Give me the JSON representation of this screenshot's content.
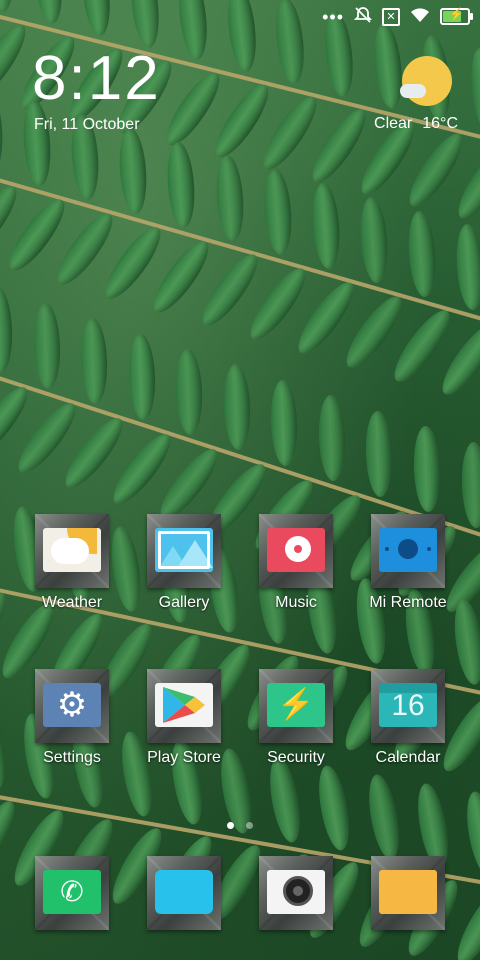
{
  "status_bar": {
    "icons": [
      "more-dots-icon",
      "mute-alarm-icon",
      "sim-error-icon",
      "wifi-icon",
      "battery-charging-icon"
    ],
    "battery_color": "#7ad45a"
  },
  "clock_widget": {
    "time": "8:12",
    "date": "Fri, 11 October",
    "weather_condition": "Clear",
    "temperature": "16°C"
  },
  "apps": [
    {
      "label": "Weather",
      "icon": "weather-icon"
    },
    {
      "label": "Gallery",
      "icon": "gallery-icon"
    },
    {
      "label": "Music",
      "icon": "music-icon"
    },
    {
      "label": "Mi Remote",
      "icon": "remote-icon"
    },
    {
      "label": "Settings",
      "icon": "gear-icon"
    },
    {
      "label": "Play Store",
      "icon": "play-store-icon"
    },
    {
      "label": "Security",
      "icon": "security-bolt-icon"
    },
    {
      "label": "Calendar",
      "icon": "calendar-icon",
      "day": "16"
    }
  ],
  "dock": [
    {
      "icon": "phone-icon"
    },
    {
      "icon": "messages-icon"
    },
    {
      "icon": "camera-icon"
    },
    {
      "icon": "browser-icon"
    }
  ],
  "page_indicator": {
    "pages": 2,
    "active": 1
  },
  "colors": {
    "wallpaper": "#2c5e35",
    "weather_sun": "#f4c84a",
    "music": "#ea4a5d",
    "mi_remote": "#1e8fdc",
    "settings": "#5d82b4",
    "security": "#2ec58a",
    "calendar": "#2bb6b8",
    "phone": "#21c06b",
    "messages": "#27c1ec",
    "browser": "#f6b743"
  }
}
